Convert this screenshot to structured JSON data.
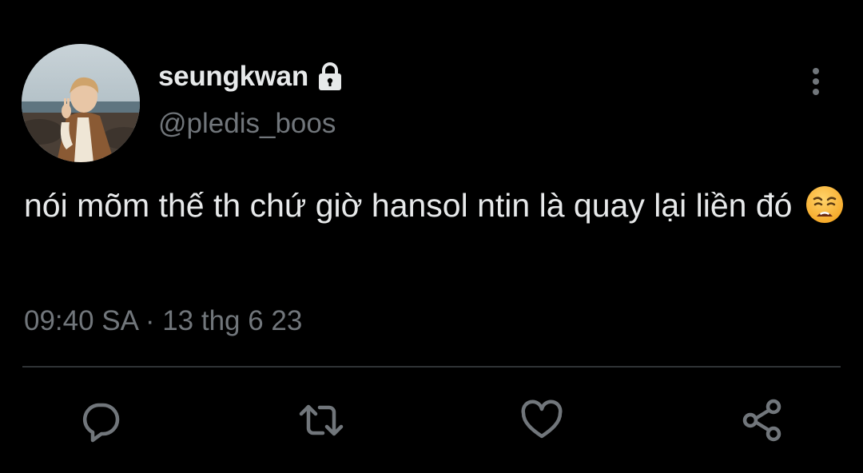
{
  "tweet": {
    "display_name": "seungkwan",
    "handle": "@pledis_boos",
    "text": "nói mõm thế th chứ giờ hansol ntin là quay lại liền đó",
    "emoji": "weary-face",
    "time": "09:40 SA",
    "separator": "·",
    "date": "13 thg 6 23",
    "protected": true
  },
  "icons": {
    "lock": "lock-icon",
    "more": "more-vertical-icon",
    "reply": "reply-icon",
    "retweet": "retweet-icon",
    "like": "heart-icon",
    "share": "share-icon"
  },
  "colors": {
    "background": "#000000",
    "primary_text": "#e7e9ea",
    "secondary_text": "#71767b",
    "divider": "#2f3336",
    "icon": "#71767b"
  }
}
